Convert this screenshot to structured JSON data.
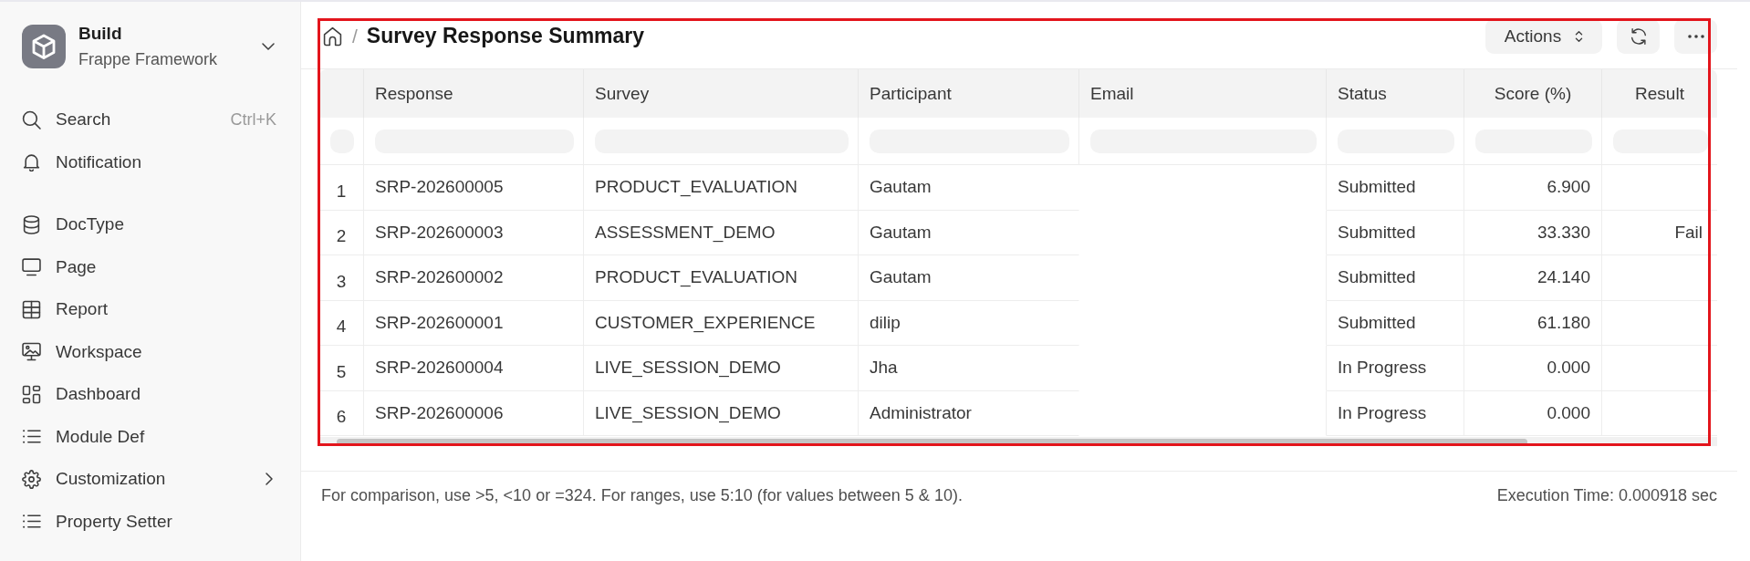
{
  "sidebar": {
    "app": {
      "title": "Build",
      "subtitle": "Frappe Framework"
    },
    "utilities": [
      {
        "label": "Search",
        "shortcut": "Ctrl+K"
      },
      {
        "label": "Notification"
      }
    ],
    "items": [
      {
        "label": "DocType",
        "kind": "link"
      },
      {
        "label": "Page",
        "kind": "link"
      },
      {
        "label": "Report",
        "kind": "link"
      },
      {
        "label": "Workspace",
        "kind": "link"
      },
      {
        "label": "Dashboard",
        "kind": "link"
      },
      {
        "label": "Module Def",
        "kind": "link"
      },
      {
        "label": "Customization",
        "kind": "group",
        "expanded": false
      },
      {
        "label": "Property Setter",
        "kind": "link"
      }
    ]
  },
  "page_header": {
    "separator": "/",
    "title": "Survey Response Summary",
    "actions_button": {
      "label": "Actions"
    }
  },
  "report_table": {
    "columns": [
      {
        "label": "Response",
        "kind": "text"
      },
      {
        "label": "Survey",
        "kind": "text"
      },
      {
        "label": "Participant",
        "kind": "text"
      },
      {
        "label": "Email",
        "kind": "text"
      },
      {
        "label": "Status",
        "kind": "text"
      },
      {
        "label": "Score (%)",
        "kind": "number"
      },
      {
        "label": "Result",
        "kind": "number"
      }
    ],
    "rows": [
      {
        "number": "1",
        "response": "SRP-202600005",
        "survey": "PRODUCT_EVALUATION",
        "participant": "Gautam",
        "status": "Submitted",
        "score": "6.900"
      },
      {
        "number": "2",
        "response": "SRP-202600003",
        "survey": "ASSESSMENT_DEMO",
        "participant": "Gautam",
        "status": "Submitted",
        "score": "33.330",
        "result": "Fail"
      },
      {
        "number": "3",
        "response": "SRP-202600002",
        "survey": "PRODUCT_EVALUATION",
        "participant": "Gautam",
        "status": "Submitted",
        "score": "24.140"
      },
      {
        "number": "4",
        "response": "SRP-202600001",
        "survey": "CUSTOMER_EXPERIENCE",
        "participant": "dilip",
        "status": "Submitted",
        "score": "61.180"
      },
      {
        "number": "5",
        "response": "SRP-202600004",
        "survey": "LIVE_SESSION_DEMO",
        "participant": "Jha",
        "status": "In Progress",
        "score": "0.000"
      },
      {
        "number": "6",
        "response": "SRP-202600006",
        "survey": "LIVE_SESSION_DEMO",
        "participant": "Administrator",
        "status": "In Progress",
        "score": "0.000"
      }
    ]
  },
  "footer": {
    "hint": "For comparison, use >5, <10 or =324. For ranges, use 5:10 (for values between 5 & 10).",
    "execution_time": "Execution Time: 0.000918 sec"
  }
}
